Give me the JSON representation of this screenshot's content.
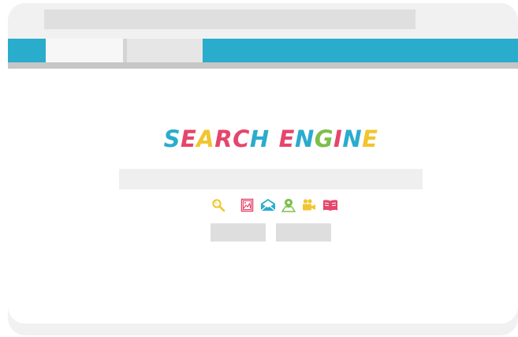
{
  "browser": {
    "address_value": "",
    "tabs": [
      {
        "label": "",
        "state": "active"
      },
      {
        "label": "",
        "state": "inactive"
      }
    ],
    "colors": {
      "tab_strip": "#2aaccd",
      "frame": "#f1f1f1",
      "toolbar_divider": "#c6c6c6"
    }
  },
  "page": {
    "logo": {
      "letters": [
        {
          "char": "S",
          "color": "#2aaccd"
        },
        {
          "char": "E",
          "color": "#e5466b"
        },
        {
          "char": "A",
          "color": "#f1c52e"
        },
        {
          "char": "R",
          "color": "#e5466b"
        },
        {
          "char": "C",
          "color": "#e5466b"
        },
        {
          "char": "H",
          "color": "#2aaccd"
        },
        {
          "char": " ",
          "color": "#ffffff"
        },
        {
          "char": "E",
          "color": "#e5466b"
        },
        {
          "char": "N",
          "color": "#2aaccd"
        },
        {
          "char": "G",
          "color": "#7dbf4a"
        },
        {
          "char": "I",
          "color": "#e5466b"
        },
        {
          "char": "N",
          "color": "#2aaccd"
        },
        {
          "char": "E",
          "color": "#f1c52e"
        }
      ]
    },
    "search": {
      "value": "",
      "placeholder": ""
    },
    "categories": [
      {
        "icon": "search-icon",
        "color": "#f1c52e"
      },
      {
        "icon": "image-icon",
        "color": "#e5466b"
      },
      {
        "icon": "mail-icon",
        "color": "#2aaccd"
      },
      {
        "icon": "map-pin-icon",
        "color": "#7dbf4a"
      },
      {
        "icon": "video-icon",
        "color": "#f1c52e"
      },
      {
        "icon": "book-icon",
        "color": "#e5466b"
      }
    ],
    "buttons": [
      {
        "label": ""
      },
      {
        "label": ""
      }
    ]
  }
}
